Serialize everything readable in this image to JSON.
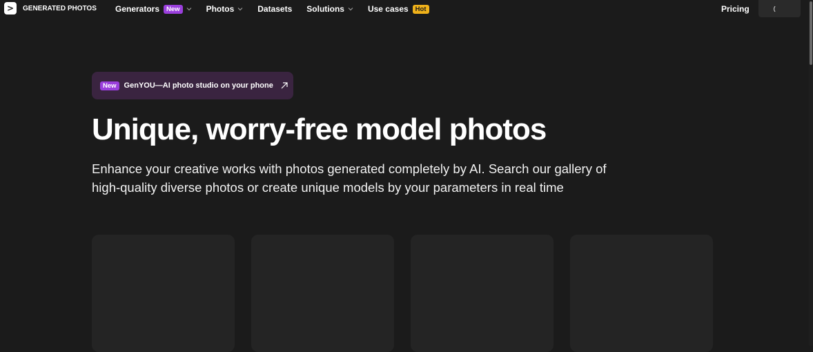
{
  "brand": {
    "name": "GENERATED PHOTOS",
    "logo_glyph": ">",
    "icon": "logo-icon"
  },
  "nav": {
    "items": [
      {
        "label": "Generators",
        "badge": "New",
        "has_dropdown": true
      },
      {
        "label": "Photos",
        "badge": "",
        "has_dropdown": true
      },
      {
        "label": "Datasets",
        "badge": "",
        "has_dropdown": false
      },
      {
        "label": "Solutions",
        "badge": "",
        "has_dropdown": true
      },
      {
        "label": "Use cases",
        "badge": "Hot",
        "has_dropdown": false
      }
    ],
    "pricing_label": "Pricing",
    "login_state": "loading-spinner-icon"
  },
  "promo": {
    "badge": "New",
    "text": "GenYOU—AI photo studio on your phone",
    "icon": "arrow-up-right-icon"
  },
  "hero": {
    "title": "Unique, worry-free model photos",
    "subtitle_line1": "Enhance your creative works with photos generated completely by AI. Search our gallery of",
    "subtitle_line2": "high-quality diverse photos or create unique models by your parameters in real time"
  },
  "colors": {
    "background": "#1b1b1b",
    "badge_new": "#9a3fdc",
    "badge_hot": "#f0b21a",
    "promo_bg": "#3a2440",
    "card_bg": "#242424"
  }
}
